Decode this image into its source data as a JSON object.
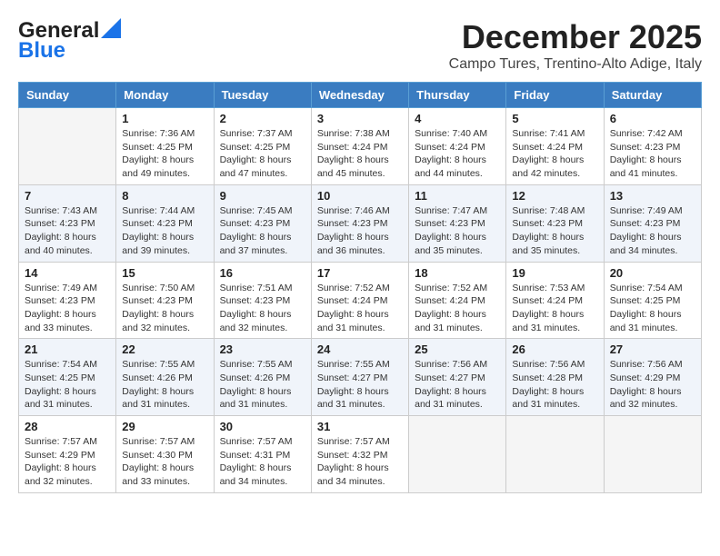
{
  "logo": {
    "line1": "General",
    "line2": "Blue"
  },
  "title": "December 2025",
  "subtitle": "Campo Tures, Trentino-Alto Adige, Italy",
  "days_of_week": [
    "Sunday",
    "Monday",
    "Tuesday",
    "Wednesday",
    "Thursday",
    "Friday",
    "Saturday"
  ],
  "weeks": [
    [
      {
        "day": "",
        "info": ""
      },
      {
        "day": "1",
        "info": "Sunrise: 7:36 AM\nSunset: 4:25 PM\nDaylight: 8 hours\nand 49 minutes."
      },
      {
        "day": "2",
        "info": "Sunrise: 7:37 AM\nSunset: 4:25 PM\nDaylight: 8 hours\nand 47 minutes."
      },
      {
        "day": "3",
        "info": "Sunrise: 7:38 AM\nSunset: 4:24 PM\nDaylight: 8 hours\nand 45 minutes."
      },
      {
        "day": "4",
        "info": "Sunrise: 7:40 AM\nSunset: 4:24 PM\nDaylight: 8 hours\nand 44 minutes."
      },
      {
        "day": "5",
        "info": "Sunrise: 7:41 AM\nSunset: 4:24 PM\nDaylight: 8 hours\nand 42 minutes."
      },
      {
        "day": "6",
        "info": "Sunrise: 7:42 AM\nSunset: 4:23 PM\nDaylight: 8 hours\nand 41 minutes."
      }
    ],
    [
      {
        "day": "7",
        "info": "Sunrise: 7:43 AM\nSunset: 4:23 PM\nDaylight: 8 hours\nand 40 minutes."
      },
      {
        "day": "8",
        "info": "Sunrise: 7:44 AM\nSunset: 4:23 PM\nDaylight: 8 hours\nand 39 minutes."
      },
      {
        "day": "9",
        "info": "Sunrise: 7:45 AM\nSunset: 4:23 PM\nDaylight: 8 hours\nand 37 minutes."
      },
      {
        "day": "10",
        "info": "Sunrise: 7:46 AM\nSunset: 4:23 PM\nDaylight: 8 hours\nand 36 minutes."
      },
      {
        "day": "11",
        "info": "Sunrise: 7:47 AM\nSunset: 4:23 PM\nDaylight: 8 hours\nand 35 minutes."
      },
      {
        "day": "12",
        "info": "Sunrise: 7:48 AM\nSunset: 4:23 PM\nDaylight: 8 hours\nand 35 minutes."
      },
      {
        "day": "13",
        "info": "Sunrise: 7:49 AM\nSunset: 4:23 PM\nDaylight: 8 hours\nand 34 minutes."
      }
    ],
    [
      {
        "day": "14",
        "info": "Sunrise: 7:49 AM\nSunset: 4:23 PM\nDaylight: 8 hours\nand 33 minutes."
      },
      {
        "day": "15",
        "info": "Sunrise: 7:50 AM\nSunset: 4:23 PM\nDaylight: 8 hours\nand 32 minutes."
      },
      {
        "day": "16",
        "info": "Sunrise: 7:51 AM\nSunset: 4:23 PM\nDaylight: 8 hours\nand 32 minutes."
      },
      {
        "day": "17",
        "info": "Sunrise: 7:52 AM\nSunset: 4:24 PM\nDaylight: 8 hours\nand 31 minutes."
      },
      {
        "day": "18",
        "info": "Sunrise: 7:52 AM\nSunset: 4:24 PM\nDaylight: 8 hours\nand 31 minutes."
      },
      {
        "day": "19",
        "info": "Sunrise: 7:53 AM\nSunset: 4:24 PM\nDaylight: 8 hours\nand 31 minutes."
      },
      {
        "day": "20",
        "info": "Sunrise: 7:54 AM\nSunset: 4:25 PM\nDaylight: 8 hours\nand 31 minutes."
      }
    ],
    [
      {
        "day": "21",
        "info": "Sunrise: 7:54 AM\nSunset: 4:25 PM\nDaylight: 8 hours\nand 31 minutes."
      },
      {
        "day": "22",
        "info": "Sunrise: 7:55 AM\nSunset: 4:26 PM\nDaylight: 8 hours\nand 31 minutes."
      },
      {
        "day": "23",
        "info": "Sunrise: 7:55 AM\nSunset: 4:26 PM\nDaylight: 8 hours\nand 31 minutes."
      },
      {
        "day": "24",
        "info": "Sunrise: 7:55 AM\nSunset: 4:27 PM\nDaylight: 8 hours\nand 31 minutes."
      },
      {
        "day": "25",
        "info": "Sunrise: 7:56 AM\nSunset: 4:27 PM\nDaylight: 8 hours\nand 31 minutes."
      },
      {
        "day": "26",
        "info": "Sunrise: 7:56 AM\nSunset: 4:28 PM\nDaylight: 8 hours\nand 31 minutes."
      },
      {
        "day": "27",
        "info": "Sunrise: 7:56 AM\nSunset: 4:29 PM\nDaylight: 8 hours\nand 32 minutes."
      }
    ],
    [
      {
        "day": "28",
        "info": "Sunrise: 7:57 AM\nSunset: 4:29 PM\nDaylight: 8 hours\nand 32 minutes."
      },
      {
        "day": "29",
        "info": "Sunrise: 7:57 AM\nSunset: 4:30 PM\nDaylight: 8 hours\nand 33 minutes."
      },
      {
        "day": "30",
        "info": "Sunrise: 7:57 AM\nSunset: 4:31 PM\nDaylight: 8 hours\nand 34 minutes."
      },
      {
        "day": "31",
        "info": "Sunrise: 7:57 AM\nSunset: 4:32 PM\nDaylight: 8 hours\nand 34 minutes."
      },
      {
        "day": "",
        "info": ""
      },
      {
        "day": "",
        "info": ""
      },
      {
        "day": "",
        "info": ""
      }
    ]
  ]
}
